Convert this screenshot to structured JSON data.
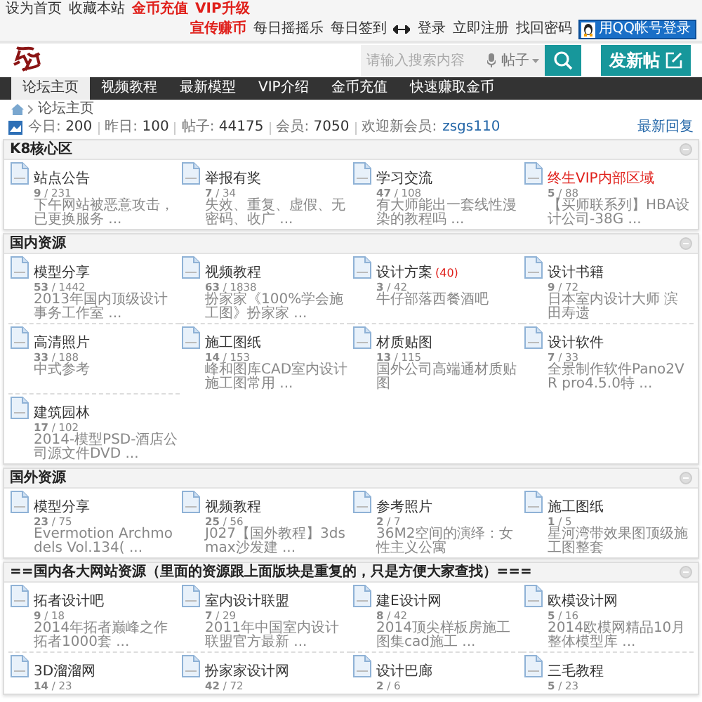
{
  "top_bar": {
    "left_links": [
      {
        "text": "设为首页",
        "highlight": false
      },
      {
        "text": "收藏本站",
        "highlight": false
      },
      {
        "text": "金币充值",
        "highlight": true
      },
      {
        "text": "VIP升级",
        "highlight": true
      }
    ],
    "promo_links": [
      {
        "text": "宣传赚币",
        "highlight": true
      },
      {
        "text": "每日摇摇乐",
        "highlight": false
      },
      {
        "text": "每日签到",
        "highlight": false
      }
    ],
    "account_links": [
      {
        "text": "登录",
        "highlight": false
      },
      {
        "text": "立即注册",
        "highlight": false
      },
      {
        "text": "找回密码",
        "highlight": false
      }
    ],
    "qq_login": "用QQ帐号登录"
  },
  "search": {
    "placeholder": "请输入搜索内容",
    "scope": "帖子"
  },
  "post_button": "发新帖",
  "nav": [
    {
      "label": "论坛主页",
      "selected": true
    },
    {
      "label": "视频教程",
      "selected": false
    },
    {
      "label": "最新模型",
      "selected": false
    },
    {
      "label": "VIP介绍",
      "selected": false
    },
    {
      "label": "金币充值",
      "selected": false
    },
    {
      "label": "快速赚取金币",
      "selected": false
    }
  ],
  "breadcrumb": [
    "论坛主页"
  ],
  "stats": {
    "items": [
      {
        "label": "今日:",
        "value": "200"
      },
      {
        "label": "昨日:",
        "value": "100"
      },
      {
        "label": "帖子:",
        "value": "44175"
      },
      {
        "label": "会员:",
        "value": "7050"
      }
    ],
    "newest_label": "欢迎新会员:",
    "newest_member": "zsgs110",
    "latest_link": "最新回复"
  },
  "sections": [
    {
      "title": "K8核心区",
      "forums": [
        {
          "name": "站点公告",
          "highlight": false,
          "stats": "**9** / 231",
          "latest": "下午网站被恶意攻击，已更换服务 ..."
        },
        {
          "name": "举报有奖",
          "highlight": false,
          "stats": "**7** / 34",
          "latest": "失效、重复、虚假、无密码、收广 ..."
        },
        {
          "name": "学习交流",
          "highlight": false,
          "stats": "**47** / 108",
          "latest": "有大师能出一套线性漫染的教程吗 ..."
        },
        {
          "name": "终生VIP内部区域",
          "highlight": true,
          "stats": "**5** / 88",
          "latest": "【买师联系列】HBA设计公司-38G ..."
        }
      ]
    },
    {
      "title": "国内资源",
      "forums": [
        {
          "name": "模型分享",
          "highlight": false,
          "stats": "**53** / 1442",
          "latest": "2013年国内顶级设计事务工作室 ..."
        },
        {
          "name": "视频教程",
          "highlight": false,
          "stats": "**63** / 1838",
          "latest": "扮家家《100%学会施工图》扮家家 ..."
        },
        {
          "name": "设计方案",
          "highlight": false,
          "new_count": "(40)",
          "stats": "**3** / 42",
          "latest": "牛仔部落西餐酒吧"
        },
        {
          "name": "设计书籍",
          "highlight": false,
          "stats": "**9** / 72",
          "latest": "日本室内设计大师 滨田寿遗"
        },
        {
          "name": "高清照片",
          "highlight": false,
          "stats": "**33** / 188",
          "latest": "中式参考"
        },
        {
          "name": "施工图纸",
          "highlight": false,
          "stats": "**14** / 153",
          "latest": "峰和图库CAD室内设计施工图常用 ..."
        },
        {
          "name": "材质贴图",
          "highlight": false,
          "stats": "**13** / 115",
          "latest": "国外公司高端通材质贴图"
        },
        {
          "name": "设计软件",
          "highlight": false,
          "stats": "**7** / 33",
          "latest": "全景制作软件Pano2VR pro4.5.0特 ..."
        },
        {
          "name": "建筑园林",
          "highlight": false,
          "stats": "**17** / 102",
          "latest": "2014-模型PSD-酒店公司源文件DVD ..."
        }
      ]
    },
    {
      "title": "国外资源",
      "forums": [
        {
          "name": "模型分享",
          "highlight": false,
          "stats": "**23** / 75",
          "latest": "Evermotion Archmodels Vol.134( ..."
        },
        {
          "name": "视频教程",
          "highlight": false,
          "stats": "**25** / 56",
          "latest": "J027【国外教程】3ds max沙发建 ..."
        },
        {
          "name": "参考照片",
          "highlight": false,
          "stats": "**2** / 7",
          "latest": "36M2空间的演绎：女性主义公寓"
        },
        {
          "name": "施工图纸",
          "highlight": false,
          "stats": "**1** / 5",
          "latest": "星河湾带效果图顶级施工图整套"
        }
      ]
    },
    {
      "title": "==国内各大网站资源（里面的资源跟上面版块是重复的，只是方便大家查找）===",
      "forums": [
        {
          "name": "拓者设计吧",
          "highlight": false,
          "stats": "**9** / 18",
          "latest": "2014年拓者巅峰之作拓者1000套 ..."
        },
        {
          "name": "室内设计联盟",
          "highlight": false,
          "stats": "**7** / 29",
          "latest": "2011年中国室内设计联盟官方最新 ..."
        },
        {
          "name": "建E设计网",
          "highlight": false,
          "stats": "**8** / 42",
          "latest": "2014顶尖样板房施工图集cad施工 ..."
        },
        {
          "name": "欧模设计网",
          "highlight": false,
          "stats": "**5** / 16",
          "latest": "2014欧模网精品10月整体模型库 ..."
        },
        {
          "name": "3D溜溜网",
          "highlight": false,
          "stats": "**14** / 23"
        },
        {
          "name": "扮家家设计网",
          "highlight": false,
          "stats": "**42** / 72"
        },
        {
          "name": "设计巴廊",
          "highlight": false,
          "stats": "**2** / 6"
        },
        {
          "name": "三毛教程",
          "highlight": false,
          "stats": "**5** / 23"
        }
      ]
    }
  ]
}
